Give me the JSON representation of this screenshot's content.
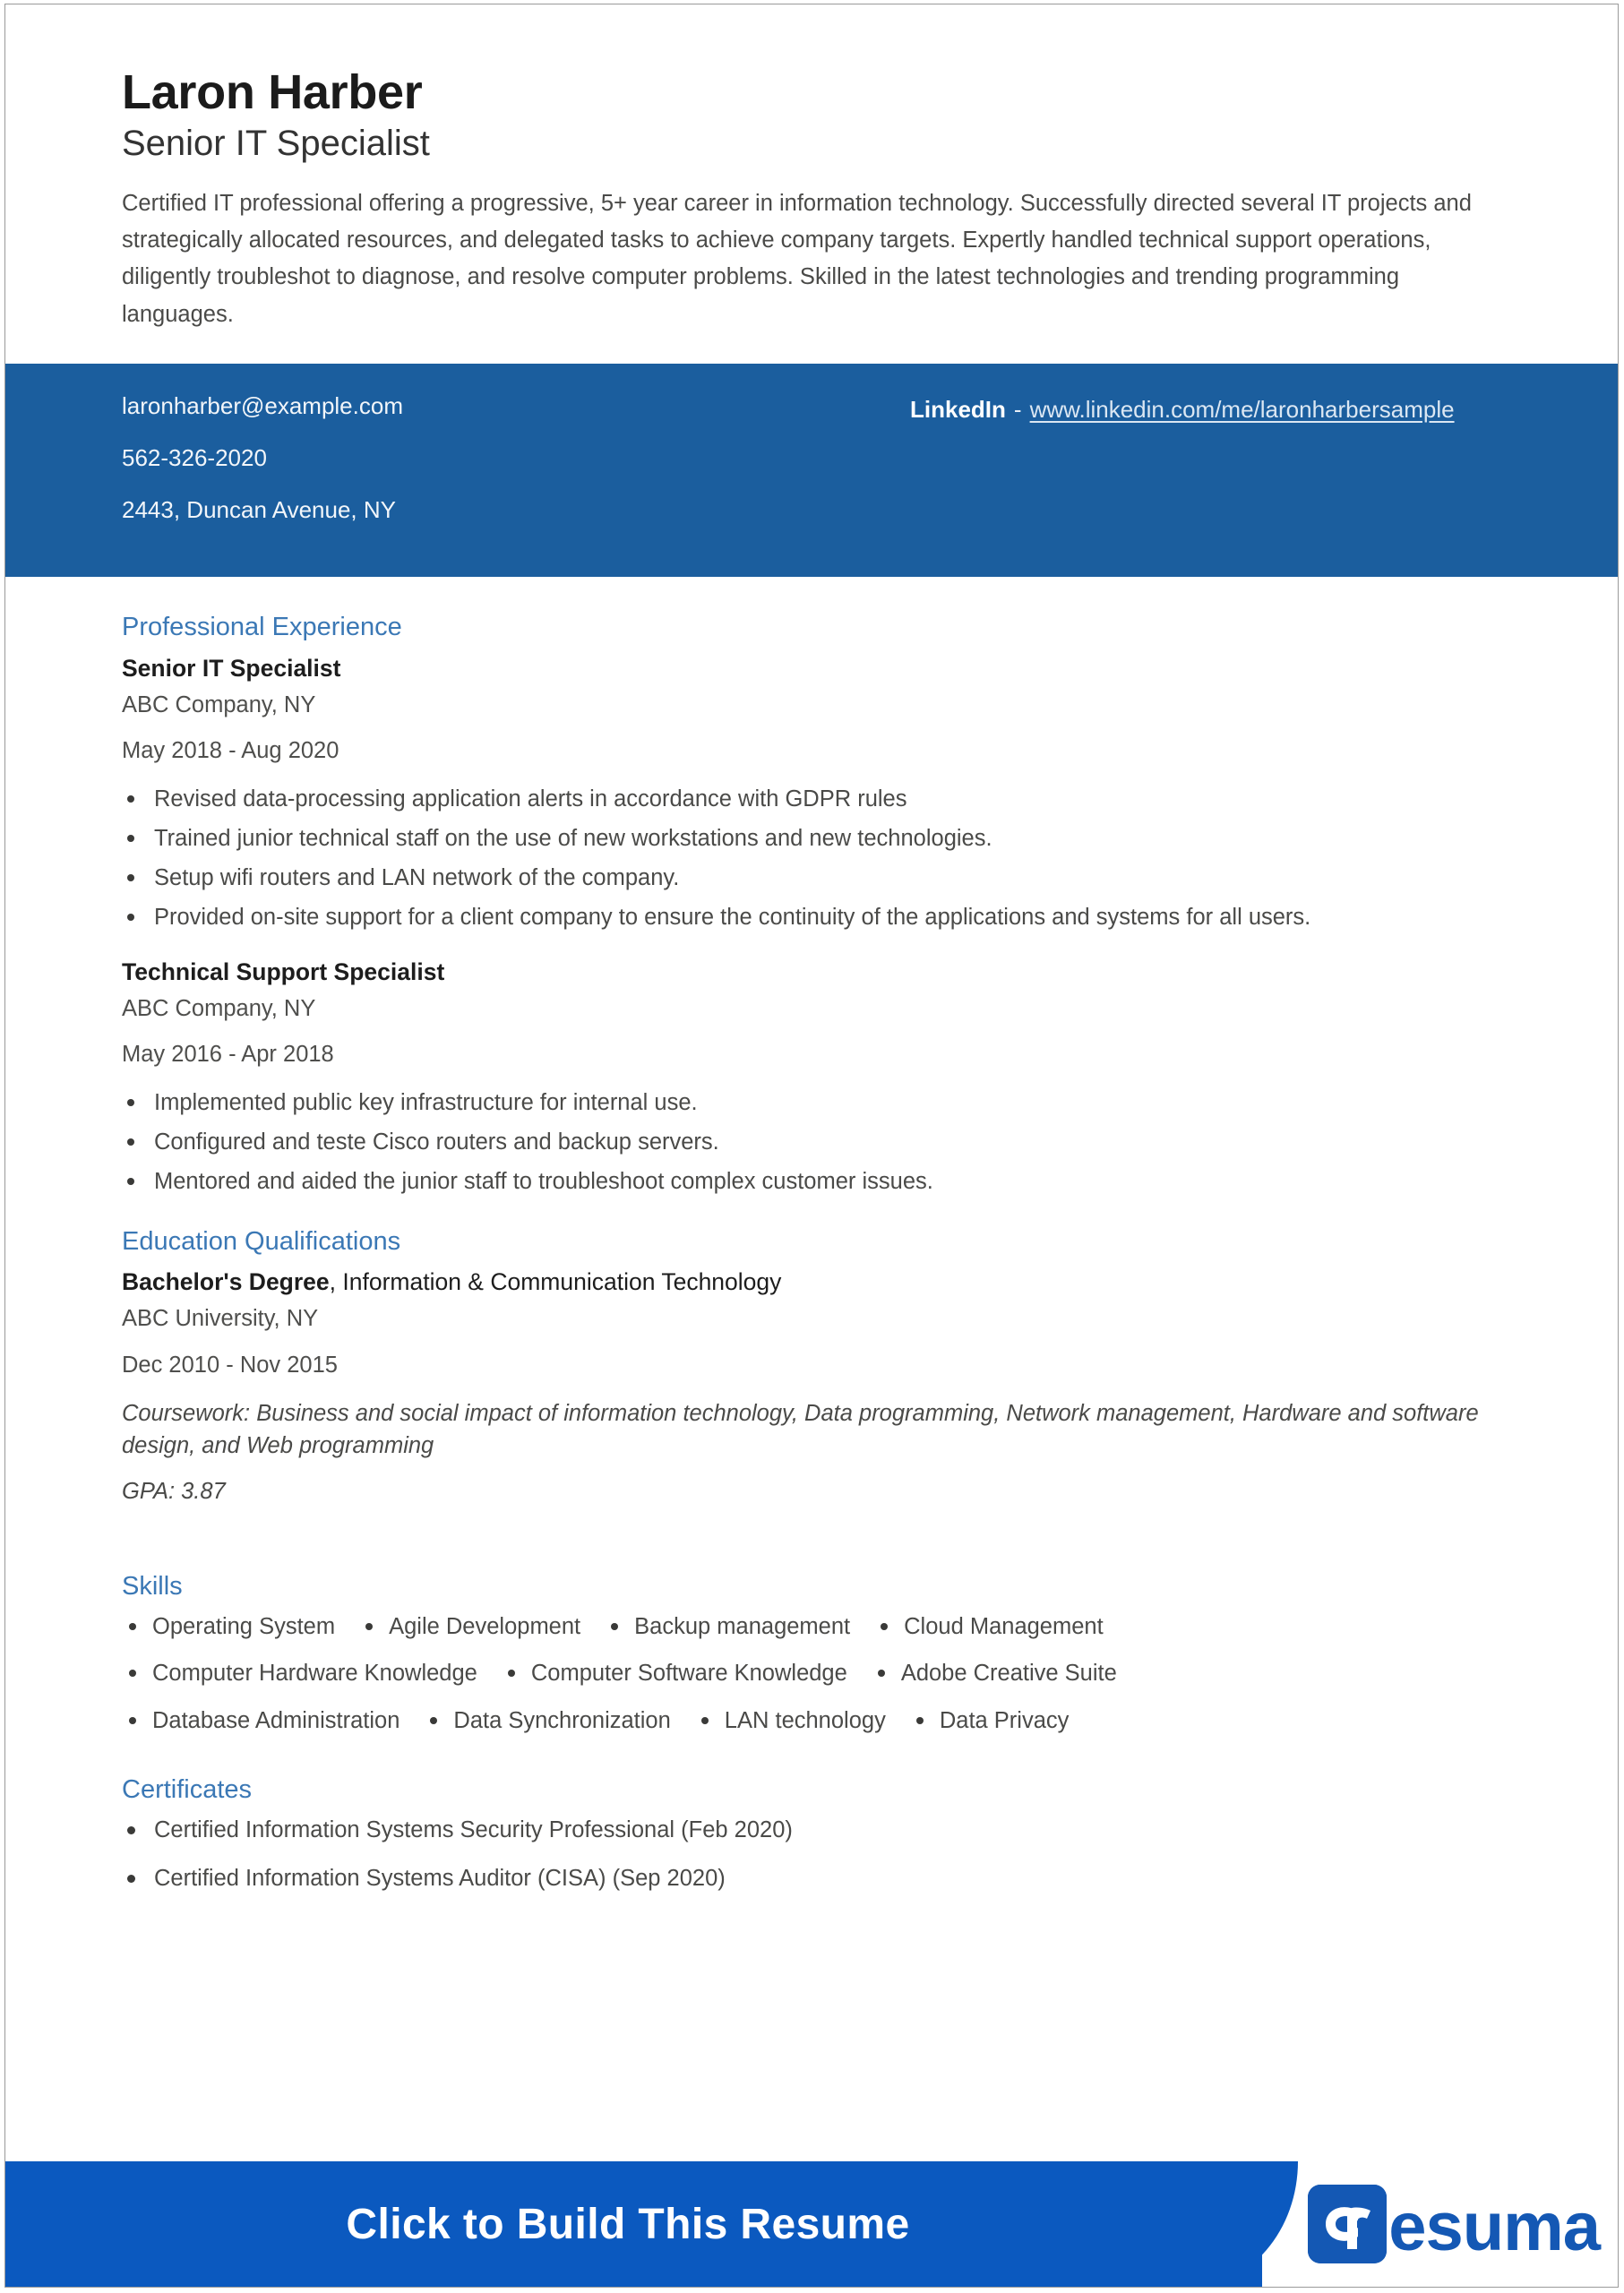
{
  "header": {
    "full_name": "Laron Harber",
    "headline": "Senior IT Specialist",
    "summary": "Certified IT professional offering a progressive, 5+ year career in information technology. Successfully directed several IT projects and strategically allocated resources, and delegated tasks to achieve company targets. Expertly handled technical support operations, diligently troubleshot to diagnose, and resolve computer problems. Skilled in the latest technologies and trending programming languages."
  },
  "contact": {
    "email": "laronharber@example.com",
    "phone": "562-326-2020",
    "address": "2443, Duncan Avenue, NY",
    "linkedin_label": "LinkedIn",
    "linkedin_dash": "-",
    "linkedin_url": "www.linkedin.com/me/laronharbersample",
    "bar_color": "#1B5E9E"
  },
  "experience": {
    "section_title": "Professional Experience",
    "jobs": [
      {
        "title": "Senior IT Specialist",
        "company": "ABC Company, NY",
        "dates": "May 2018 - Aug 2020",
        "bullets": [
          "Revised data-processing application alerts in accordance with GDPR rules",
          "Trained junior technical staff on the use of new workstations and new technologies.",
          "Setup wifi routers and LAN network of the company.",
          "Provided on-site support for a client company to ensure the continuity of the applications and systems for all users."
        ]
      },
      {
        "title": "Technical Support Specialist",
        "company": "ABC Company, NY",
        "dates": "May 2016 - Apr 2018",
        "bullets": [
          "Implemented public key infrastructure for internal use.",
          "Configured and teste Cisco routers and backup servers.",
          "Mentored and aided the junior staff to troubleshoot complex customer issues."
        ]
      }
    ]
  },
  "education": {
    "section_title": "Education Qualifications",
    "degree_bold": "Bachelor's Degree",
    "degree_rest": ", Information & Communication Technology",
    "school": "ABC University, NY",
    "dates": "Dec 2010 - Nov 2015",
    "coursework": "Coursework: Business and social impact of information technology, Data programming, Network management, Hardware and software design, and Web programming",
    "gpa": "GPA: 3.87"
  },
  "skills": {
    "section_title": "Skills",
    "rows": [
      [
        "Operating System",
        "Agile Development",
        "Backup management",
        "Cloud Management"
      ],
      [
        "Computer Hardware Knowledge",
        "Computer Software Knowledge",
        "Adobe Creative Suite"
      ],
      [
        "Database Administration",
        "Data Synchronization",
        "LAN technology",
        "Data Privacy"
      ]
    ]
  },
  "certificates": {
    "section_title": "Certificates",
    "items": [
      "Certified Information Systems Security Professional  (Feb 2020)",
      "Certified Information Systems Auditor (CISA)  (Sep 2020)"
    ]
  },
  "footer": {
    "cta_label": "Click to Build This Resume",
    "brand_mark_letters": "CR",
    "brand_text": "esuma",
    "bar_color": "#0B59BF",
    "brand_color": "#1458B4"
  },
  "theme": {
    "heading_color": "#3B78B5",
    "body_text_color": "#4a4a48"
  }
}
